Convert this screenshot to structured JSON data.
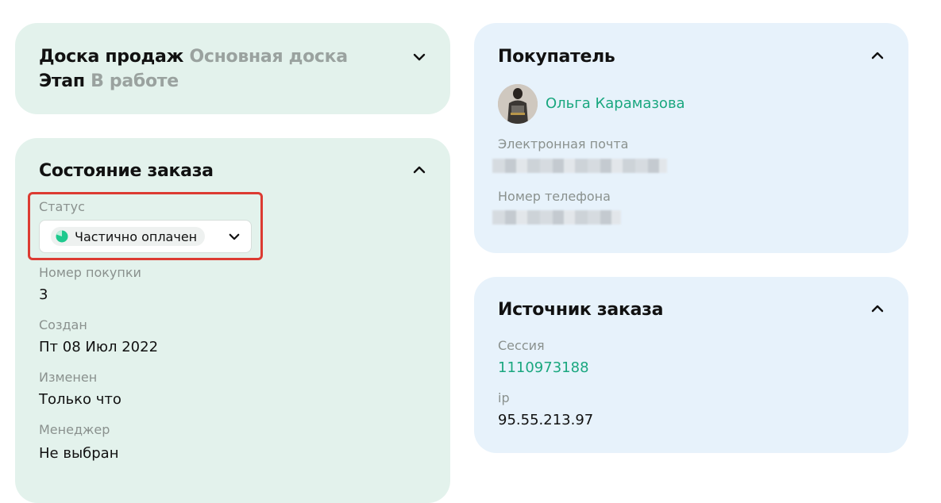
{
  "sales_board": {
    "board_label": "Доска продаж",
    "board_value": "Основная доска",
    "stage_label": "Этап",
    "stage_value": "В работе"
  },
  "order_state": {
    "title": "Состояние заказа",
    "status_label": "Статус",
    "status_value": "Частично оплачен",
    "status_color": "#1ec98e",
    "purchase_number_label": "Номер покупки",
    "purchase_number_value": "3",
    "created_label": "Создан",
    "created_value": "Пт 08 Июл 2022",
    "changed_label": "Изменен",
    "changed_value": "Только что",
    "manager_label": "Менеджер",
    "manager_value": "Не выбран"
  },
  "buyer": {
    "title": "Покупатель",
    "name": "Ольга Карамазова",
    "email_label": "Электронная почта",
    "phone_label": "Номер телефона"
  },
  "order_source": {
    "title": "Источник заказа",
    "session_label": "Сессия",
    "session_value": "1110973188",
    "ip_label": "ip",
    "ip_value": "95.55.213.97"
  },
  "icons": {
    "collapse": "chevron-up-icon",
    "expand": "chevron-down-icon",
    "status": "status-pie-icon"
  },
  "colors": {
    "green_card": "#e3f2ec",
    "blue_card": "#e7f2fb",
    "accent": "#1aa77f",
    "highlight": "#dc3b32"
  }
}
